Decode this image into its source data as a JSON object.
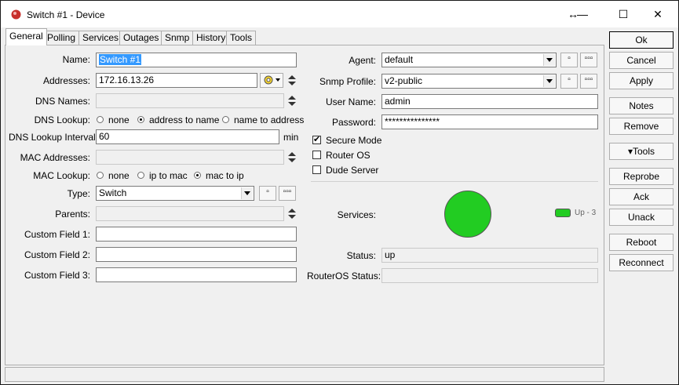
{
  "window": {
    "title": "Switch #1 - Device"
  },
  "titlebar": {
    "resize_glyph": "↔",
    "min_glyph": "—",
    "max_glyph": "☐",
    "close_glyph": "✕"
  },
  "tabs": [
    "General",
    "Polling",
    "Services",
    "Outages",
    "Snmp",
    "History",
    "Tools"
  ],
  "form": {
    "name": {
      "label": "Name:",
      "value": "Switch #1"
    },
    "addresses": {
      "label": "Addresses:",
      "value": "172.16.13.26"
    },
    "dns_names": {
      "label": "DNS Names:",
      "value": ""
    },
    "dns_lookup": {
      "label": "DNS Lookup:",
      "options": [
        "none",
        "address to name",
        "name to address"
      ],
      "selected": "address to name"
    },
    "dns_interval": {
      "label": "DNS Lookup Interval:",
      "value": "60",
      "unit": "min"
    },
    "mac_addresses": {
      "label": "MAC Addresses:",
      "value": ""
    },
    "mac_lookup": {
      "label": "MAC Lookup:",
      "options": [
        "none",
        "ip to mac",
        "mac to ip"
      ],
      "selected": "mac to ip"
    },
    "type": {
      "label": "Type:",
      "value": "Switch"
    },
    "parents": {
      "label": "Parents:",
      "value": ""
    },
    "custom1": {
      "label": "Custom Field 1:",
      "value": ""
    },
    "custom2": {
      "label": "Custom Field 2:",
      "value": ""
    },
    "custom3": {
      "label": "Custom Field 3:",
      "value": ""
    },
    "agent": {
      "label": "Agent:",
      "value": "default"
    },
    "snmp_profile": {
      "label": "Snmp Profile:",
      "value": "v2-public"
    },
    "user_name": {
      "label": "User Name:",
      "value": "admin"
    },
    "password": {
      "label": "Password:",
      "value": "***************"
    },
    "secure_mode": {
      "label": "Secure Mode",
      "checked": true
    },
    "router_os": {
      "label": "Router OS",
      "checked": false
    },
    "dude_server": {
      "label": "Dude Server",
      "checked": false
    },
    "services": {
      "label": "Services:",
      "badge": "Up - 3",
      "color": "#22cc22"
    },
    "status": {
      "label": "Status:",
      "value": "up"
    },
    "routeros_status": {
      "label": "RouterOS Status:",
      "value": ""
    },
    "small_btn": "▫",
    "more_btn": "▫▫▫"
  },
  "buttons": {
    "ok": "Ok",
    "cancel": "Cancel",
    "apply": "Apply",
    "notes": "Notes",
    "remove": "Remove",
    "tools": "▾Tools",
    "reprobe": "Reprobe",
    "ack": "Ack",
    "unack": "Unack",
    "reboot": "Reboot",
    "reconnect": "Reconnect"
  }
}
